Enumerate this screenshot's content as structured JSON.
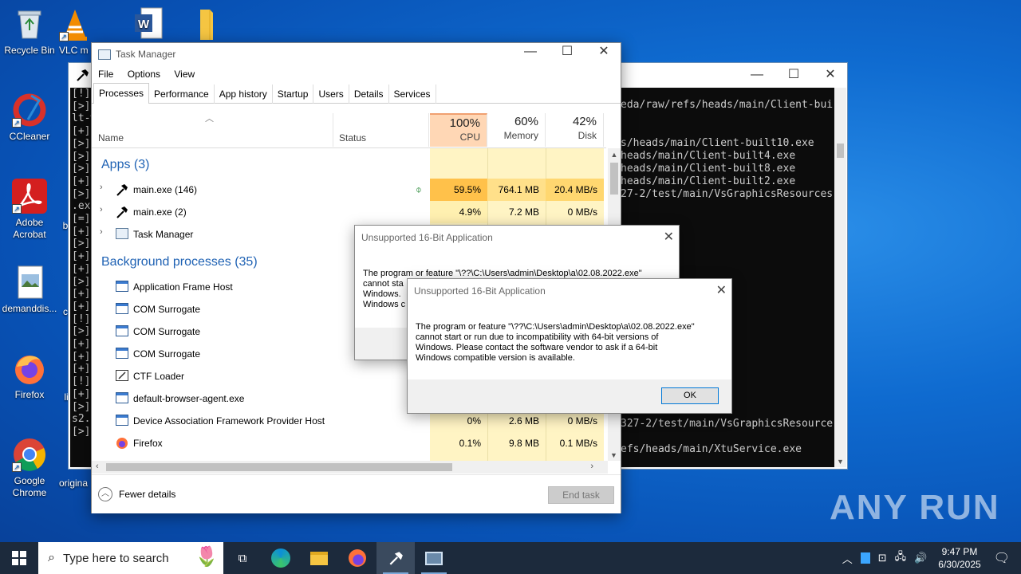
{
  "desktop": {
    "icons": [
      {
        "label": "Recycle Bin",
        "icon": "recycle-bin-icon"
      },
      {
        "label": "VLC m",
        "icon": "vlc-icon"
      },
      {
        "label": "",
        "icon": "word-icon"
      },
      {
        "label": "",
        "icon": "folder-icon"
      },
      {
        "label": "CCleaner",
        "icon": "ccleaner-icon"
      },
      {
        "label": "Adobe Acrobat",
        "icon": "acrobat-icon"
      },
      {
        "label": "demanddis...",
        "icon": "image-file-icon"
      },
      {
        "label": "Firefox",
        "icon": "firefox-icon"
      },
      {
        "label": "Google Chrome",
        "icon": "chrome-icon"
      }
    ],
    "partial_labels": [
      "b",
      "c",
      "li",
      "origina"
    ]
  },
  "console": {
    "lines_left": [
      "[!]",
      "[>]",
      "lt-w",
      "[+]",
      "[>]",
      "[>]",
      "[>]",
      "[+]",
      "[>]",
      ".exe",
      "[=]",
      "[+]",
      "[>]",
      "[+]",
      "[+]",
      "[>]",
      "[+]",
      "[+]",
      "[!]",
      "[>]",
      "[+]",
      "[+]",
      "[+]",
      "[!]",
      "[+]",
      "[>]",
      "s2.e",
      "[>]"
    ],
    "lines_right": [
      {
        "text": "eda/raw/refs/heads/main/Client-bui"
      },
      {
        "text": "s/heads/main/Client-built10.exe"
      },
      {
        "text": "heads/main/Client-built4.exe"
      },
      {
        "text": "heads/main/Client-built8.exe"
      },
      {
        "text": "heads/main/Client-built2.exe"
      },
      {
        "text": "27-2/test/main/VsGraphicsResources"
      },
      {
        "text": "327-2/test/main/VsGraphicsResource"
      },
      {
        "text": "efs/heads/main/XtuService.exe"
      }
    ]
  },
  "task_manager": {
    "title": "Task Manager",
    "menu": [
      "File",
      "Options",
      "View"
    ],
    "tabs": [
      "Processes",
      "Performance",
      "App history",
      "Startup",
      "Users",
      "Details",
      "Services"
    ],
    "columns": {
      "name": "Name",
      "status": "Status",
      "cpu_pct": "100%",
      "cpu": "CPU",
      "mem_pct": "60%",
      "mem": "Memory",
      "disk_pct": "42%",
      "disk": "Disk"
    },
    "apps_header": "Apps (3)",
    "apps": [
      {
        "name": "main.exe (146)",
        "cpu": "59.5%",
        "memory": "764.1 MB",
        "disk": "20.4 MB/s"
      },
      {
        "name": "main.exe (2)",
        "cpu": "4.9%",
        "memory": "7.2 MB",
        "disk": "0 MB/s"
      },
      {
        "name": "Task Manager",
        "cpu": "",
        "memory": "",
        "disk": ""
      }
    ],
    "bg_header": "Background processes (35)",
    "bg": [
      {
        "name": "Application Frame Host",
        "cpu": "",
        "memory": "",
        "disk": ""
      },
      {
        "name": "COM Surrogate",
        "cpu": "",
        "memory": "",
        "disk": ""
      },
      {
        "name": "COM Surrogate",
        "cpu": "",
        "memory": "",
        "disk": ""
      },
      {
        "name": "COM Surrogate",
        "cpu": "",
        "memory": "",
        "disk": ""
      },
      {
        "name": "CTF Loader",
        "cpu": "",
        "memory": "",
        "disk": ""
      },
      {
        "name": "default-browser-agent.exe",
        "cpu": "",
        "memory": "",
        "disk": ""
      },
      {
        "name": "Device Association Framework Provider Host",
        "cpu": "0%",
        "memory": "2.6 MB",
        "disk": "0 MB/s"
      },
      {
        "name": "Firefox",
        "cpu": "0.1%",
        "memory": "9.8 MB",
        "disk": "0.1 MB/s"
      }
    ],
    "fewer_details": "Fewer details",
    "end_task": "End task"
  },
  "dialog_back": {
    "title": "Unsupported 16-Bit Application",
    "lines": [
      "The program or feature \"\\??\\C:\\Users\\admin\\Desktop\\a\\02.08.2022.exe\"",
      "cannot sta",
      "Windows.",
      "Windows c"
    ]
  },
  "dialog_front": {
    "title": "Unsupported 16-Bit Application",
    "lines": [
      "The program or feature \"\\??\\C:\\Users\\admin\\Desktop\\a\\02.08.2022.exe\"",
      "cannot start or run due to incompatibility with 64-bit versions of",
      "Windows. Please contact the software vendor to ask if a 64-bit",
      "Windows compatible version is available."
    ],
    "ok": "OK"
  },
  "taskbar": {
    "search_placeholder": "Type here to search",
    "time": "9:47 PM",
    "date": "6/30/2025"
  },
  "watermark": "ANY RUN"
}
